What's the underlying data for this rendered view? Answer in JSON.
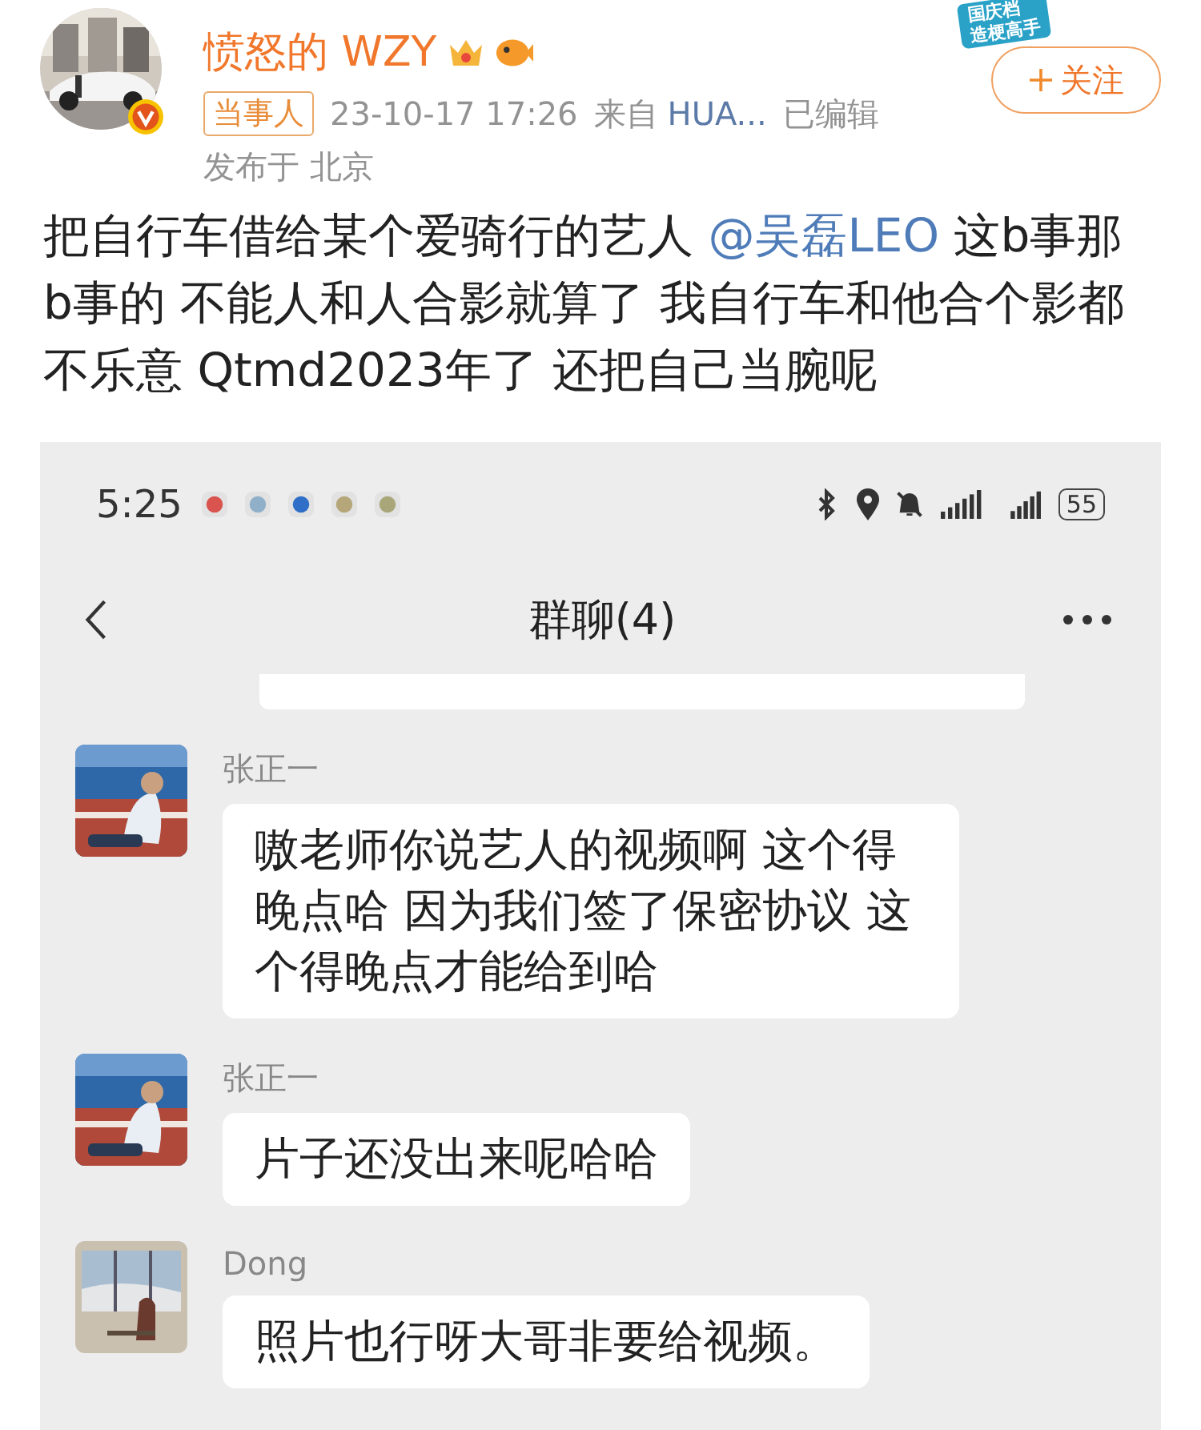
{
  "author": {
    "name": "愤怒的 WZY",
    "tag": "当事人",
    "time": "23-10-17 17:26",
    "source_prefix": "来自",
    "source": "HUA...",
    "edited": "已编辑",
    "location": "发布于 北京"
  },
  "sticker": {
    "lines": [
      "国庆档",
      "造梗高手"
    ]
  },
  "follow_button": {
    "label": "关注"
  },
  "post": {
    "before": "把自行车借给某个爱骑行的艺人 ",
    "mention": "@吴磊LEO",
    "after": " 这b事那b事的 不能人和人合影就算了 我自行车和他合个影都不乐意 Qtmd2023年了 还把自己当腕呢"
  },
  "screenshot": {
    "status_bar": {
      "time": "5:25",
      "battery": "55"
    },
    "title": "群聊(4)",
    "messages": [
      {
        "sender": "张正一",
        "text": "嗷老师你说艺人的视频啊 这个得晚点哈 因为我们签了保密协议 这个得晚点才能给到哈"
      },
      {
        "sender": "张正一",
        "text": "片子还没出来呢哈哈"
      },
      {
        "sender": "Dong",
        "text": "照片也行呀大哥非要给视频。"
      }
    ]
  }
}
